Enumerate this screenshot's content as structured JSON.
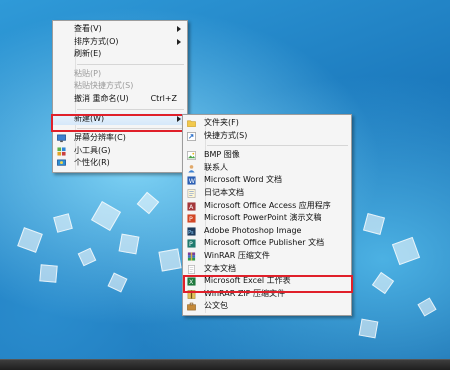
{
  "context_menu": {
    "items": [
      {
        "label": "查看(V)",
        "submenu": true
      },
      {
        "label": "排序方式(O)",
        "submenu": true
      },
      {
        "label": "刷新(E)"
      },
      {
        "label": "粘贴(P)",
        "disabled": true
      },
      {
        "label": "粘贴快捷方式(S)",
        "disabled": true
      },
      {
        "label": "撤消 重命名(U)",
        "shortcut": "Ctrl+Z"
      },
      {
        "label": "新建(W)",
        "submenu": true
      },
      {
        "label": "屏幕分辨率(C)",
        "icon": "monitor-icon"
      },
      {
        "label": "小工具(G)",
        "icon": "gadgets-icon"
      },
      {
        "label": "个性化(R)",
        "icon": "personalize-icon"
      }
    ]
  },
  "new_submenu": {
    "items": [
      {
        "label": "文件夹(F)",
        "icon": "folder-icon"
      },
      {
        "label": "快捷方式(S)",
        "icon": "shortcut-icon"
      },
      {
        "label": "BMP 图像",
        "icon": "bmp-icon"
      },
      {
        "label": "联系人",
        "icon": "contact-icon"
      },
      {
        "label": "Microsoft Word 文档",
        "icon": "word-icon"
      },
      {
        "label": "日记本文档",
        "icon": "journal-icon"
      },
      {
        "label": "Microsoft Office Access 应用程序",
        "icon": "access-icon"
      },
      {
        "label": "Microsoft PowerPoint 演示文稿",
        "icon": "powerpoint-icon"
      },
      {
        "label": "Adobe Photoshop Image",
        "icon": "photoshop-icon"
      },
      {
        "label": "Microsoft Office Publisher 文档",
        "icon": "publisher-icon"
      },
      {
        "label": "WinRAR 压缩文件",
        "icon": "winrar-icon"
      },
      {
        "label": "文本文档",
        "icon": "text-document-icon"
      },
      {
        "label": "Microsoft Excel 工作表",
        "icon": "excel-icon"
      },
      {
        "label": "WinRAR ZIP 压缩文件",
        "icon": "winrar-zip-icon"
      },
      {
        "label": "公文包",
        "icon": "briefcase-icon"
      }
    ]
  },
  "colors": {
    "highlight": "#e0202a",
    "menu_bg": "#f5f5f5",
    "desktop": "#1d7fc1"
  }
}
